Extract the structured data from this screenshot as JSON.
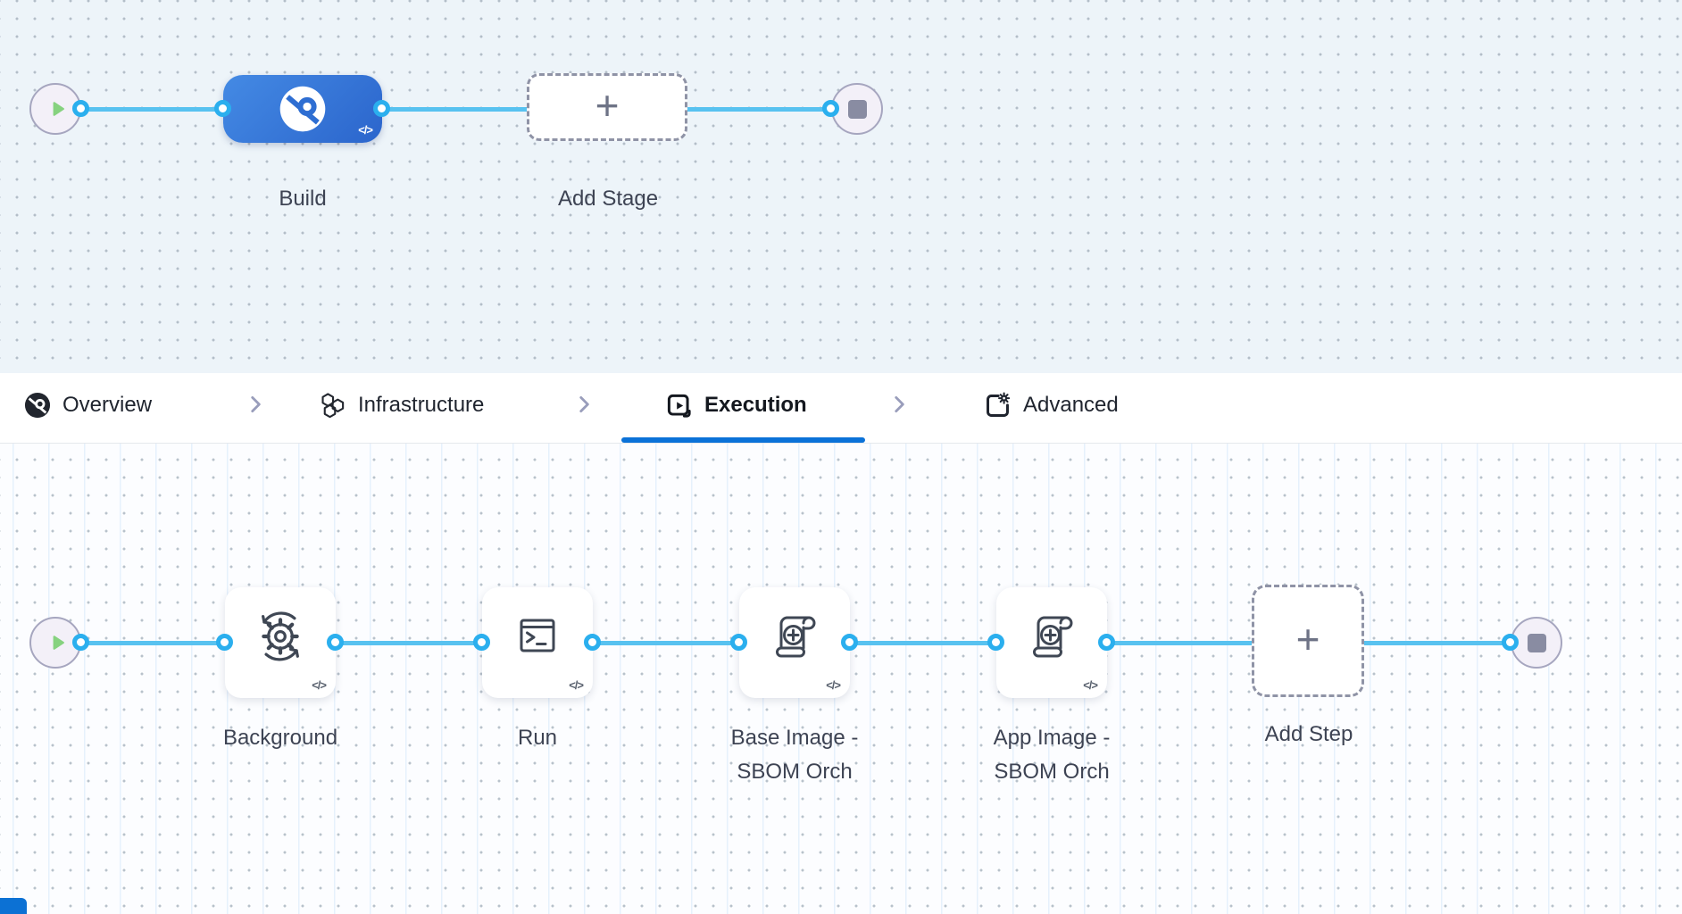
{
  "pipeline": {
    "stage_row": {
      "stage": {
        "label": "Build",
        "icon": "ci-build-icon",
        "code_badge": "</>"
      },
      "add_stage": {
        "label": "Add Stage",
        "plus": "+"
      }
    },
    "tab_bar": {
      "tabs": [
        {
          "label": "Overview",
          "icon": "ci-overview-icon",
          "active": false
        },
        {
          "label": "Infrastructure",
          "icon": "hexagons-icon",
          "active": false
        },
        {
          "label": "Execution",
          "icon": "play-square-icon",
          "active": true
        },
        {
          "label": "Advanced",
          "icon": "square-gear-icon",
          "active": false
        }
      ]
    },
    "execution_row": {
      "steps": [
        {
          "label": "Background",
          "icon": "background-sync-icon",
          "code_badge": "</>"
        },
        {
          "label": "Run",
          "icon": "terminal-icon",
          "code_badge": "</>"
        },
        {
          "label": "Base Image - SBOM Orch",
          "icon": "sbom-scroll-icon",
          "code_badge": "</>"
        },
        {
          "label": "App Image - SBOM Orch",
          "icon": "sbom-scroll-icon",
          "code_badge": "</>"
        }
      ],
      "add_step": {
        "label": "Add Step",
        "plus": "+"
      }
    },
    "colors": {
      "accent_blue": "#0b72d8",
      "connector_line": "#58c2f0",
      "connector_ring": "#2bafee",
      "stage_gradient_start": "#448ae4",
      "stage_gradient_end": "#2b65cc",
      "play_green": "#86d27f",
      "stop_gray": "#898ca2"
    }
  }
}
